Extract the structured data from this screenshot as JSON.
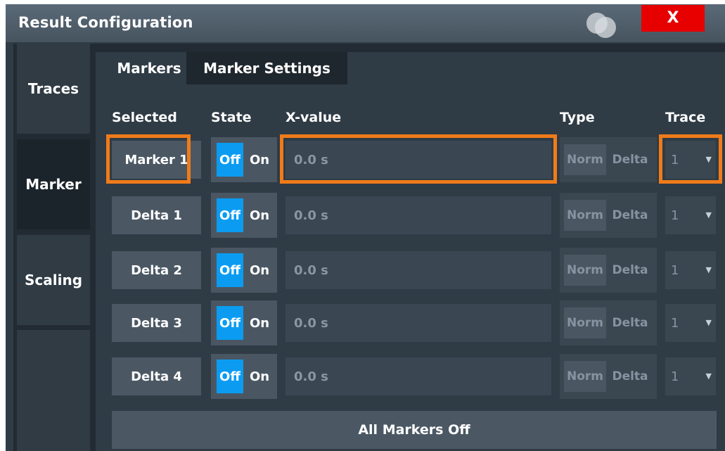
{
  "window": {
    "title": "Result Configuration",
    "close_label": "X"
  },
  "side_tabs": [
    {
      "label": "Traces",
      "active": false
    },
    {
      "label": "Marker",
      "active": true
    },
    {
      "label": "Scaling",
      "active": false
    }
  ],
  "tabs": [
    {
      "label": "Markers",
      "active": true
    },
    {
      "label": "Marker Settings",
      "active": false
    }
  ],
  "columns": {
    "selected": "Selected",
    "state": "State",
    "x_value": "X-value",
    "type": "Type",
    "trace": "Trace"
  },
  "rows": [
    {
      "name": "Marker 1",
      "state_off": "Off",
      "state_on": "On",
      "x_value": "0.0 s",
      "type_norm": "Norm",
      "type_delta": "Delta",
      "trace": "1",
      "highlighted": true
    },
    {
      "name": "Delta 1",
      "state_off": "Off",
      "state_on": "On",
      "x_value": "0.0 s",
      "type_norm": "Norm",
      "type_delta": "Delta",
      "trace": "1",
      "highlighted": false
    },
    {
      "name": "Delta 2",
      "state_off": "Off",
      "state_on": "On",
      "x_value": "0.0 s",
      "type_norm": "Norm",
      "type_delta": "Delta",
      "trace": "1",
      "highlighted": false
    },
    {
      "name": "Delta 3",
      "state_off": "Off",
      "state_on": "On",
      "x_value": "0.0 s",
      "type_norm": "Norm",
      "type_delta": "Delta",
      "trace": "1",
      "highlighted": false
    },
    {
      "name": "Delta 4",
      "state_off": "Off",
      "state_on": "On",
      "x_value": "0.0 s",
      "type_norm": "Norm",
      "type_delta": "Delta",
      "trace": "1",
      "highlighted": false
    }
  ],
  "all_markers_off_label": "All Markers Off",
  "colors": {
    "highlight": "#f07b19",
    "state_off_active": "#0b9cf2",
    "close_button": "#e60000"
  },
  "icons": {
    "close": "close-icon",
    "window_decoration": "overlapping-circles-icon",
    "dropdown": "chevron-down-icon"
  }
}
